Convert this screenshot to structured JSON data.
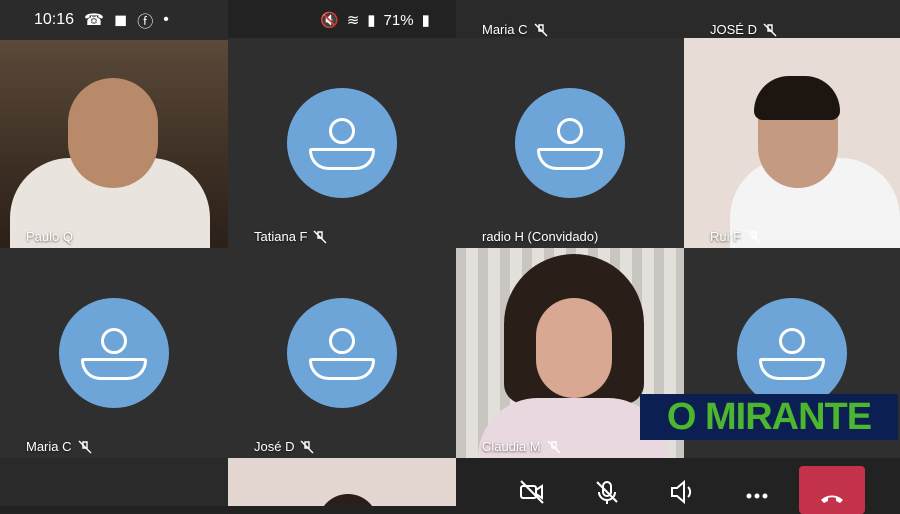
{
  "status_bar": {
    "time": "10:16",
    "battery": "71%"
  },
  "tiles": [
    {
      "name": "Paulo Q",
      "muted": false
    },
    {
      "name": "Tatiana F",
      "muted": true
    },
    {
      "name": "radio H (Convidado)",
      "muted": false
    },
    {
      "name": "Rui F",
      "muted": true
    },
    {
      "name": "Maria C",
      "muted": true
    },
    {
      "name": "José D",
      "muted": true
    },
    {
      "name": "Cláudia M",
      "muted": true
    },
    {
      "name": "",
      "muted": false
    }
  ],
  "top_strip": [
    {
      "name": "Maria C",
      "muted": true
    },
    {
      "name": "JOSÉ D",
      "muted": true
    }
  ],
  "watermark": "O MIRANTE",
  "colors": {
    "avatar": "#6ea5d8",
    "hangup": "#c4314b",
    "logo_bg": "#0c1f52",
    "logo_text": "#4bb62e"
  },
  "controls": [
    {
      "icon": "video-off-icon"
    },
    {
      "icon": "mic-off-icon"
    },
    {
      "icon": "speaker-icon"
    },
    {
      "icon": "more-icon"
    },
    {
      "icon": "hangup-icon"
    }
  ]
}
